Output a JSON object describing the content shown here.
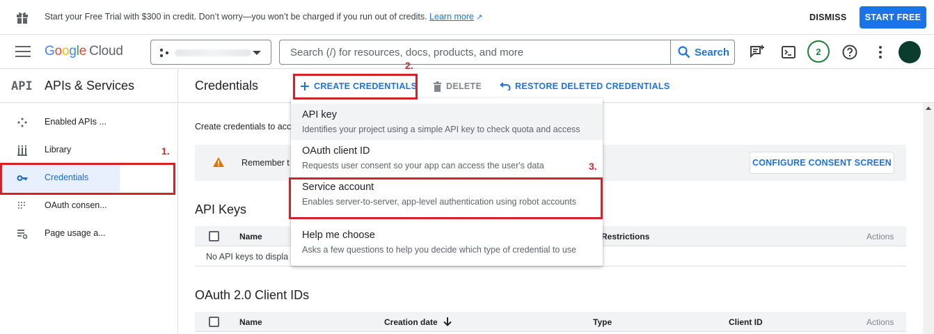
{
  "promo": {
    "message": "Start your Free Trial with $300 in credit. Don’t worry—you won’t be charged if you run out of credits.",
    "learn_more": "Learn more",
    "dismiss": "DISMISS",
    "start_free": "START FREE"
  },
  "topnav": {
    "logo_google": [
      "G",
      "o",
      "o",
      "g",
      "l",
      "e"
    ],
    "logo_cloud": "Cloud",
    "search_placeholder": "Search (/) for resources, docs, products, and more",
    "search_button": "Search",
    "notifications_count": "2"
  },
  "sidebar": {
    "api_icon": "API",
    "title": "APIs & Services",
    "items": [
      {
        "label": "Enabled APIs ...",
        "icon": "enabled-apis-icon"
      },
      {
        "label": "Library",
        "icon": "library-icon"
      },
      {
        "label": "Credentials",
        "icon": "key-icon",
        "active": true
      },
      {
        "label": "OAuth consen...",
        "icon": "oauth-consent-icon"
      },
      {
        "label": "Page usage a...",
        "icon": "page-usage-icon"
      }
    ]
  },
  "main": {
    "title": "Credentials",
    "toolbar": {
      "create": "CREATE CREDENTIALS",
      "delete": "DELETE",
      "restore": "RESTORE DELETED CREDENTIALS"
    },
    "intro": "Create credentials to acc",
    "alert_text": "Remember t",
    "configure_consent": "CONFIGURE CONSENT SCREEN",
    "api_keys": {
      "title": "API Keys",
      "columns": [
        "Name",
        "Restrictions",
        "Actions"
      ],
      "empty": "No API keys to displa"
    },
    "oauth": {
      "title": "OAuth 2.0 Client IDs",
      "columns": [
        "Name",
        "Creation date",
        "Type",
        "Client ID",
        "Actions"
      ]
    }
  },
  "menu": {
    "items": [
      {
        "title": "API key",
        "desc": "Identifies your project using a simple API key to check quota and access"
      },
      {
        "title": "OAuth client ID",
        "desc": "Requests user consent so your app can access the user's data"
      },
      {
        "title": "Service account",
        "desc": "Enables server-to-server, app-level authentication using robot accounts"
      },
      {
        "title": "Help me choose",
        "desc": "Asks a few questions to help you decide which type of credential to use"
      }
    ]
  },
  "annotations": {
    "step1": "1.",
    "step2": "2.",
    "step3": "3.",
    "color": "#d3222a"
  },
  "colors": {
    "accent": "#1a73e8",
    "active_bg": "#e8f0fe",
    "warning": "#e37400"
  }
}
